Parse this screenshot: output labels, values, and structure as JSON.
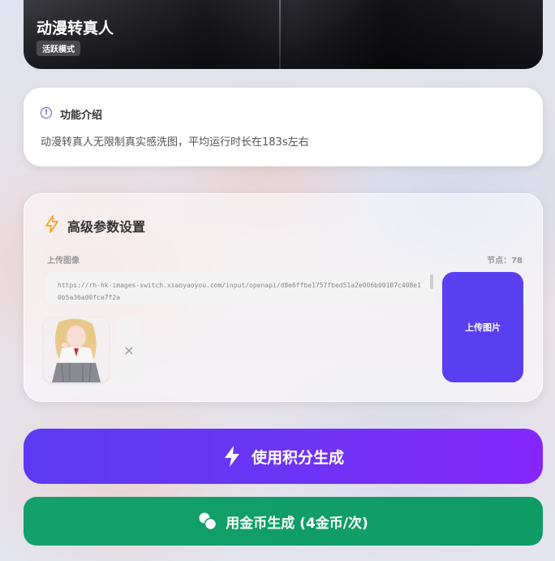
{
  "hero": {
    "title": "动漫转真人",
    "badge": "活跃模式"
  },
  "intro": {
    "title": "功能介绍",
    "description": "动漫转真人无限制真实感洗图，平均运行时长在183s左右",
    "icon": "info-circle-icon"
  },
  "params": {
    "title": "高级参数设置",
    "icon": "bolt-icon",
    "upload_label": "上传图像",
    "node_label": "节点：78",
    "image_url": "https://rh-hk-images-switch.xiaoyaoyou.com/input/openapi/d8e6ffbe1757fbed51a2e006b00187c408e10b5a36a00fce7f2a",
    "upload_button": "上传图片",
    "remove_symbol": "×"
  },
  "actions": {
    "points_button": "使用积分生成",
    "coins_button": "用金币生成 (4金币/次)",
    "points_icon": "lightning-icon",
    "coins_icon": "coins-icon"
  },
  "colors": {
    "accent_purple": "#5a3ff0",
    "accent_green": "#13a06a",
    "bolt_orange": "#f5a623"
  }
}
